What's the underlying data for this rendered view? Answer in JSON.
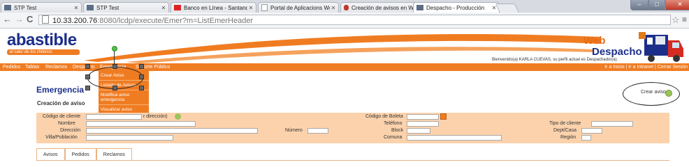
{
  "browser": {
    "tabs": [
      {
        "title": "STP Test",
        "active": false
      },
      {
        "title": "STP Test",
        "active": false
      },
      {
        "title": "Banco en Línea - Santand",
        "active": false
      },
      {
        "title": "Portal de Aplicacions Web",
        "active": false
      },
      {
        "title": "Creación de avisos en WE",
        "active": false
      },
      {
        "title": "Despacho - Producción",
        "active": true
      }
    ],
    "url_host": "10.33.200.76",
    "url_path": ":8080/lcdp/execute/Emer?m=ListEmerHeader",
    "window_buttons": {
      "minimize": "–",
      "maximize": "□",
      "close": "✕"
    }
  },
  "header": {
    "logo_text": "abastible",
    "logo_slogan": "el calor de los chilenos",
    "brand_line1": "Web",
    "brand_line2": "Despacho",
    "welcome": "Bienvenido(a) KARLA CUEVAS, su perfil actual es Despachador(a)."
  },
  "nav": {
    "items": [
      "Pedidos",
      "Tablas",
      "Reclamos",
      "Despacho",
      "Emergencia",
      "Soporte Público"
    ],
    "right_links": "Ir a Inicio | Ir a Intranet | Cerrar Sesión"
  },
  "emergencia_menu": {
    "items": [
      "Crear Aviso",
      "Listado de Avisos",
      "Modifica aviso emergencia",
      "Visualizar aviso emergencia"
    ]
  },
  "main": {
    "title": "Emergencia",
    "subtitle": "Creación de aviso",
    "crear_aviso": "Crear aviso"
  },
  "form": {
    "codigo_cliente": "Código de cliente",
    "buscar_direccion": "r dirección)",
    "codigo_boleta": "Código de Boleta",
    "nombre": "Nombre",
    "telefono": "Teléfono",
    "tipo_cliente": "Tipo de cliente",
    "direccion": "Dirección",
    "numero": "Número",
    "block": "Block",
    "dept_casa": "Dept/Casa",
    "villa": "Villa/Población",
    "comuna": "Comuna",
    "region": "Región"
  },
  "page_tabs": [
    "Avisos",
    "Pedidos",
    "Reclamos"
  ],
  "colors": {
    "brand_orange": "#f07c22",
    "brand_blue": "#1b2f8a",
    "form_bg": "#fbd2ac"
  }
}
